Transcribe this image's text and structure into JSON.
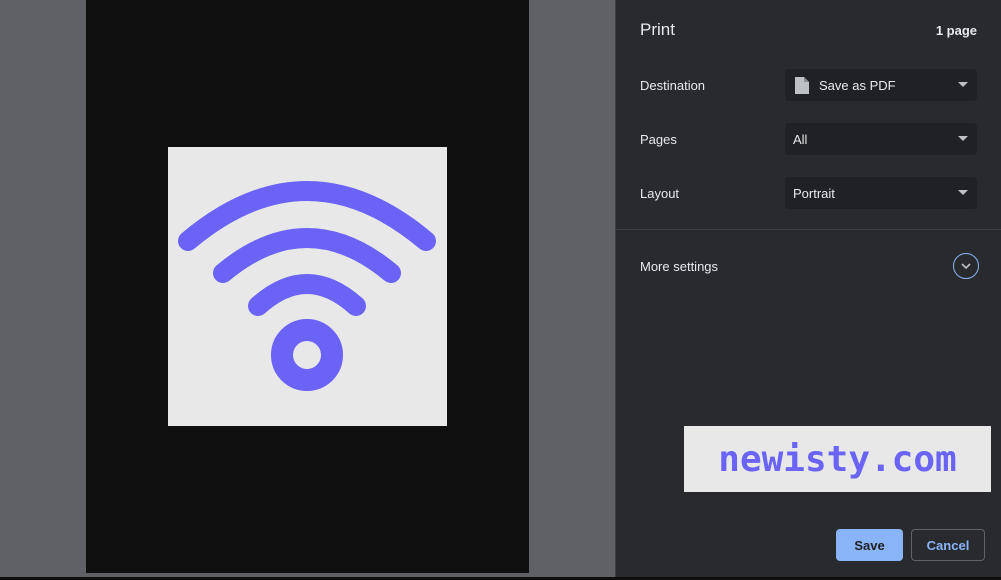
{
  "panel": {
    "title": "Print",
    "page_count": "1 page"
  },
  "settings": {
    "destination": {
      "label": "Destination",
      "value": "Save as PDF",
      "icon": "document-icon"
    },
    "pages": {
      "label": "Pages",
      "value": "All"
    },
    "layout": {
      "label": "Layout",
      "value": "Portrait"
    }
  },
  "more_settings": {
    "label": "More settings",
    "icon": "chevron-down-icon"
  },
  "buttons": {
    "save": "Save",
    "cancel": "Cancel"
  },
  "preview": {
    "image_icon": "wifi-icon",
    "icon_color": "#6a63f6"
  },
  "watermark": {
    "text": "newisty.com"
  },
  "colors": {
    "accent": "#8ab4f8",
    "panel_bg": "#292a2d",
    "select_bg": "#202124"
  }
}
